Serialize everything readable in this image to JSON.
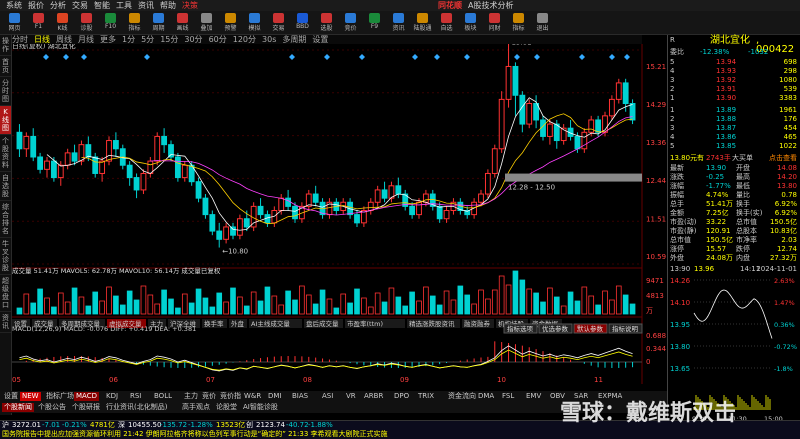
{
  "menubar": {
    "items": [
      "系统",
      "报价",
      "分析",
      "交易",
      "智能",
      "工具",
      "资讯",
      "帮助",
      "决策"
    ],
    "brand": "同花顺",
    "product": "A股技术分析",
    "right": [
      "热点",
      "高抬盘口利器",
      "戴维斯双击"
    ]
  },
  "toolbar": {
    "buttons": [
      "网页",
      "F1",
      "K线",
      "诊股",
      "F10",
      "指标",
      "周期",
      "画线",
      "叠加",
      "预警",
      "模拟",
      "交易",
      "BBD",
      "选股",
      "竞价",
      "F9",
      "资讯",
      "陆股通",
      "自选",
      "板块",
      "问财",
      "指标",
      "退出"
    ]
  },
  "periodbar": {
    "items": [
      "分时",
      "日线",
      "周线",
      "月线",
      "更多",
      "1分",
      "5分",
      "15分",
      "30分",
      "60分",
      "120分",
      "30s",
      "多周期",
      "设置"
    ],
    "selected": "日线"
  },
  "leftrail": {
    "items": [
      "操作",
      "首页",
      "分时图",
      "K线图",
      "个股资料",
      "自选股",
      "综合排名",
      "牛叉诊股",
      "超级盘口",
      "资讯"
    ],
    "active": "K线图"
  },
  "chart": {
    "title": "日线(复权)  湖北宜化",
    "price_axis": [
      "15.21",
      "14.29",
      "13.36",
      "12.44",
      "11.51",
      "10.59"
    ],
    "high_label": "15.81",
    "low_label": "10.80",
    "range_label": "12.28 - 12.50",
    "candles": [
      [
        13.6,
        13.2,
        13.8,
        13.0
      ],
      [
        13.2,
        13.5,
        13.6,
        13.0
      ],
      [
        13.5,
        13.0,
        13.7,
        12.9
      ],
      [
        13.0,
        12.7,
        13.1,
        12.6
      ],
      [
        12.7,
        12.9,
        13.0,
        12.5
      ],
      [
        12.9,
        12.5,
        13.0,
        12.4
      ],
      [
        12.5,
        12.8,
        12.9,
        12.3
      ],
      [
        12.8,
        13.1,
        13.2,
        12.7
      ],
      [
        13.1,
        12.9,
        13.3,
        12.8
      ],
      [
        12.9,
        13.3,
        13.4,
        12.8
      ],
      [
        13.3,
        13.0,
        13.5,
        12.9
      ],
      [
        13.0,
        12.6,
        13.1,
        12.5
      ],
      [
        12.6,
        12.9,
        13.0,
        12.4
      ],
      [
        12.9,
        13.4,
        13.5,
        12.8
      ],
      [
        13.4,
        13.2,
        13.6,
        13.0
      ],
      [
        13.2,
        12.8,
        13.3,
        12.7
      ],
      [
        12.8,
        12.5,
        12.9,
        12.3
      ],
      [
        12.5,
        12.2,
        12.6,
        12.0
      ],
      [
        12.2,
        12.6,
        12.7,
        12.1
      ],
      [
        12.6,
        12.9,
        13.0,
        12.5
      ],
      [
        12.9,
        13.5,
        13.6,
        12.8
      ],
      [
        13.5,
        13.3,
        13.7,
        13.1
      ],
      [
        13.3,
        13.0,
        13.4,
        12.9
      ],
      [
        13.0,
        12.5,
        13.1,
        12.4
      ],
      [
        12.5,
        12.8,
        12.9,
        12.4
      ],
      [
        12.8,
        12.4,
        12.9,
        12.3
      ],
      [
        12.4,
        12.0,
        12.5,
        11.9
      ],
      [
        12.0,
        11.6,
        12.1,
        11.5
      ],
      [
        11.6,
        11.2,
        11.7,
        11.1
      ],
      [
        11.2,
        11.0,
        11.4,
        10.8
      ],
      [
        11.0,
        11.3,
        11.4,
        10.9
      ],
      [
        11.3,
        11.1,
        11.4,
        11.0
      ],
      [
        11.1,
        11.5,
        11.6,
        11.0
      ],
      [
        11.5,
        11.3,
        11.7,
        11.2
      ],
      [
        11.3,
        11.8,
        11.9,
        11.2
      ],
      [
        11.8,
        11.6,
        12.0,
        11.5
      ],
      [
        11.6,
        11.4,
        11.7,
        11.3
      ],
      [
        11.4,
        11.7,
        11.8,
        11.3
      ],
      [
        11.7,
        12.0,
        12.1,
        11.6
      ],
      [
        12.0,
        11.8,
        12.2,
        11.7
      ],
      [
        11.8,
        11.5,
        11.9,
        11.4
      ],
      [
        11.5,
        11.8,
        11.9,
        11.4
      ],
      [
        11.8,
        12.1,
        12.2,
        11.7
      ],
      [
        12.1,
        11.9,
        12.3,
        11.8
      ],
      [
        11.9,
        11.6,
        12.0,
        11.5
      ],
      [
        11.6,
        11.9,
        12.0,
        11.5
      ],
      [
        11.9,
        11.7,
        12.0,
        11.6
      ],
      [
        11.7,
        11.9,
        12.0,
        11.6
      ],
      [
        11.9,
        11.6,
        12.0,
        11.5
      ],
      [
        11.6,
        11.4,
        11.7,
        11.3
      ],
      [
        11.4,
        11.7,
        11.8,
        11.3
      ],
      [
        11.7,
        11.9,
        12.0,
        11.6
      ],
      [
        11.9,
        12.2,
        12.3,
        11.8
      ],
      [
        12.2,
        12.0,
        12.4,
        11.9
      ],
      [
        12.0,
        12.3,
        12.4,
        11.9
      ],
      [
        12.3,
        12.1,
        12.5,
        12.0
      ],
      [
        12.1,
        11.8,
        12.2,
        11.7
      ],
      [
        11.8,
        11.6,
        11.9,
        11.5
      ],
      [
        11.6,
        11.9,
        12.0,
        11.5
      ],
      [
        11.9,
        12.1,
        12.2,
        11.8
      ],
      [
        12.1,
        11.8,
        12.2,
        11.7
      ],
      [
        11.8,
        11.5,
        11.9,
        11.4
      ],
      [
        11.5,
        11.7,
        11.8,
        11.4
      ],
      [
        11.7,
        11.9,
        12.0,
        11.6
      ],
      [
        11.9,
        11.7,
        12.0,
        11.6
      ],
      [
        11.7,
        11.6,
        11.8,
        11.5
      ],
      [
        11.6,
        11.9,
        12.0,
        11.5
      ],
      [
        11.9,
        12.1,
        12.2,
        11.8
      ],
      [
        12.1,
        12.6,
        12.7,
        12.0
      ],
      [
        12.6,
        13.2,
        13.3,
        12.5
      ],
      [
        13.2,
        14.4,
        14.6,
        13.1
      ],
      [
        14.4,
        15.2,
        15.81,
        14.2
      ],
      [
        15.2,
        14.5,
        15.3,
        14.0
      ],
      [
        14.5,
        13.8,
        14.6,
        13.6
      ],
      [
        13.8,
        14.3,
        14.4,
        13.7
      ],
      [
        14.3,
        13.9,
        14.5,
        13.7
      ],
      [
        13.9,
        13.5,
        14.0,
        13.4
      ],
      [
        13.5,
        13.8,
        13.9,
        13.3
      ],
      [
        13.8,
        13.4,
        13.9,
        13.2
      ],
      [
        13.4,
        13.7,
        13.8,
        13.3
      ],
      [
        13.7,
        13.5,
        13.9,
        13.4
      ],
      [
        13.5,
        13.2,
        13.6,
        13.1
      ],
      [
        13.2,
        13.6,
        13.7,
        13.1
      ],
      [
        13.6,
        13.9,
        14.0,
        13.5
      ],
      [
        13.9,
        13.6,
        14.0,
        13.5
      ],
      [
        13.6,
        14.0,
        14.1,
        13.5
      ],
      [
        14.0,
        14.4,
        14.5,
        13.9
      ],
      [
        14.4,
        14.8,
        14.9,
        14.3
      ],
      [
        14.8,
        14.3,
        14.9,
        14.1
      ],
      [
        14.3,
        13.9,
        14.4,
        13.8
      ]
    ],
    "vol_header": "成交量 51.41万  MAVOL5: 62.78万  MAVOL10: 56.14万  成交量已复权",
    "vol_axis": [
      "9471",
      "4813",
      "万"
    ],
    "sub_tabs": [
      "设置",
      "成交量",
      "多周期成交量",
      "虚拟成交量",
      "主力",
      "沪深全维",
      "换手率",
      "外盘",
      "AI主线成交量",
      "盘后成交量",
      "市盈率(ttm)",
      "精选涨跌股资讯",
      "融资融券",
      "机构持股",
      "资金数据"
    ],
    "macd_header": "MACD(12,26,9)  MACD: -0.076  DIFF: +0.419  DEA: +0.381",
    "macd_buttons": [
      "指标选项",
      "优选参数",
      "默认参数",
      "指标说明"
    ],
    "macd_axis": [
      "0.688",
      "0.344",
      "0"
    ],
    "date_axis": [
      "05",
      "06",
      "07",
      "08",
      "09",
      "10",
      "11"
    ]
  },
  "bottomtabs": {
    "row1": [
      "设置",
      "NEW",
      "指标广场",
      "MACD",
      "KDJ",
      "RSI",
      "BOLL",
      "主力",
      "竞价",
      "竞价指",
      "W&R",
      "DMI",
      "BIAS",
      "ASI",
      "VR",
      "ARBR",
      "DPO",
      "TRIX",
      "资金流向",
      "DMA",
      "FSL",
      "EMV",
      "OBV",
      "SAR",
      "EXPMA"
    ],
    "row1_selected": "MACD",
    "row2": [
      "个股新闻",
      "个股公告",
      "个股研报",
      "行业资讯(北化制品)",
      "高手观点",
      "论股堂",
      "AI智能诊股"
    ]
  },
  "quote": {
    "tag": "R",
    "name": "湖北宜化",
    "code": "000422",
    "wei": {
      "label": "委比",
      "pct": "-12.38%",
      "diff": "-1032"
    },
    "asks": [
      {
        "level": "5",
        "price": "13.94",
        "vol": "698"
      },
      {
        "level": "4",
        "price": "13.93",
        "vol": "298"
      },
      {
        "level": "3",
        "price": "13.92",
        "vol": "1080"
      },
      {
        "level": "2",
        "price": "13.91",
        "vol": "539"
      },
      {
        "level": "1",
        "price": "13.90",
        "vol": "3383"
      }
    ],
    "bids": [
      {
        "level": "1",
        "price": "13.89",
        "vol": "1961"
      },
      {
        "level": "2",
        "price": "13.88",
        "vol": "176"
      },
      {
        "level": "3",
        "price": "13.87",
        "vol": "454"
      },
      {
        "level": "4",
        "price": "13.86",
        "vol": "465"
      },
      {
        "level": "5",
        "price": "13.85",
        "vol": "1022"
      }
    ],
    "trade": {
      "price": "13.80元有",
      "qty": "2743手",
      "label": "大买单",
      "link": "点击查看"
    },
    "stats": [
      [
        "最新",
        "13.90",
        "开盘",
        "14.08"
      ],
      [
        "涨跌",
        "-0.25",
        "最高",
        "14.20"
      ],
      [
        "涨幅",
        "-1.77%",
        "最低",
        "13.80"
      ],
      [
        "振幅",
        "4.74%",
        "量比",
        "0.78"
      ],
      [
        "总手",
        "51.41万",
        "换手",
        "6.92%"
      ],
      [
        "金额",
        "7.25亿",
        "换手(实)",
        "6.92%"
      ],
      [
        "市盈(动)",
        "33.22",
        "总市值",
        "150.5亿"
      ],
      [
        "市盈(静)",
        "120.91",
        "总股本",
        "10.83亿"
      ],
      [
        "总市值",
        "150.5亿",
        "市净率",
        "2.03"
      ],
      [
        "涨停",
        "15.57",
        "跌停",
        "12.74"
      ],
      [
        "外盘",
        "24.08万",
        "内盘",
        "27.32万"
      ]
    ],
    "minute_header": {
      "time": "13:90",
      "price": "13.96",
      "right_time": "14:11",
      "date": "2024-11-01"
    },
    "minute_axis": [
      "14.26",
      "14.10",
      "13.95",
      "13.80",
      "13.65"
    ],
    "minute_pct": [
      "2.63%",
      "1.47%",
      "0.36%",
      "-0.72%",
      "-1.8%"
    ],
    "minute_times": [
      "9:30",
      "11:30",
      "15:00"
    ]
  },
  "statusbar": {
    "index1": "沪",
    "v1": "3272.01",
    "c1": "-7.01",
    "p1": "-0.21%",
    "a1": "4781亿",
    "idx2": "深",
    "v2": "10455.50",
    "c2": "-135.72",
    "p2": "-1.28%",
    "a2": "13523亿",
    "idx3": "创",
    "v3": "2123.74",
    "c3": "-40.72",
    "p3": "-1.88%",
    "news": "国务院报告中提出应加强资源循环利用  21:42 伊朗阿拉格齐将称以色列军事行动是“确定的”  21:33 李希观看大剧院正式实施"
  },
  "watermark": "雪球：戴维斯双击",
  "colors": {
    "up": "#ff3232",
    "down": "#00d2d2",
    "accent": "#e33",
    "bg": "#000000"
  }
}
